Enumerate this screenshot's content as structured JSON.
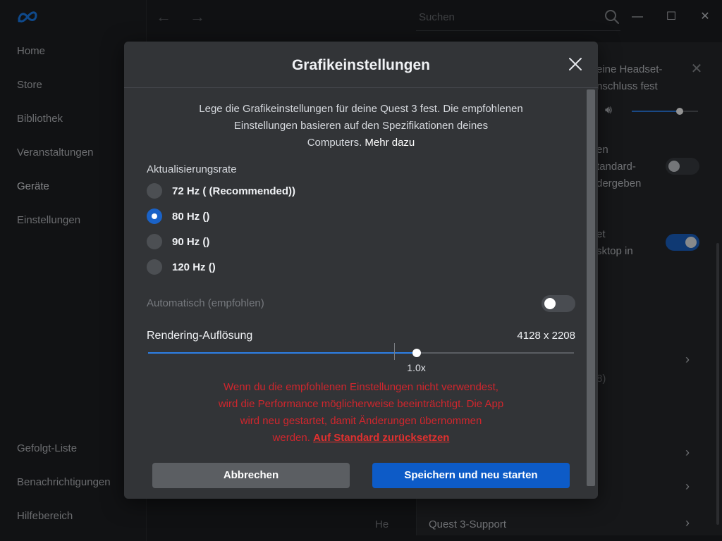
{
  "sidebar": {
    "items": [
      {
        "label": "Home"
      },
      {
        "label": "Store"
      },
      {
        "label": "Bibliothek"
      },
      {
        "label": "Veranstaltungen"
      },
      {
        "label": "Geräte"
      },
      {
        "label": "Einstellungen"
      }
    ],
    "bottom_items": [
      {
        "label": "Gefolgt-Liste"
      },
      {
        "label": "Benachrichtigungen"
      },
      {
        "label": "Hilfebereich"
      }
    ]
  },
  "topbar": {
    "search_placeholder": "Suchen"
  },
  "right_panel": {
    "line1": "eine Headset-",
    "line2": "nschluss fest",
    "line3": "en",
    "line4": "tandard-",
    "line5": "dergeben",
    "line6": "et",
    "line7": "sktop in",
    "line8": "8)",
    "help_fragment": "He",
    "support_label": "Quest 3-Support",
    "toggle1_on": false,
    "toggle2_on": true,
    "volume_level": 0.72
  },
  "dialog": {
    "title": "Grafikeinstellungen",
    "intro_line1": "Lege die Grafikeinstellungen für deine Quest 3 fest. Die empfohlenen",
    "intro_line2": "Einstellungen basieren auf den Spezifikationen deines",
    "intro_line3": "Computers.",
    "intro_link": "Mehr dazu",
    "refresh_label": "Aktualisierungsrate",
    "refresh_options": [
      {
        "label": "72 Hz ( (Recommended))",
        "checked": false
      },
      {
        "label": "80 Hz ()",
        "checked": true
      },
      {
        "label": "90 Hz ()",
        "checked": false
      },
      {
        "label": "120 Hz ()",
        "checked": false
      }
    ],
    "auto_label": "Automatisch (empfohlen)",
    "auto_on": false,
    "resolution_label": "Rendering-Auflösung",
    "resolution_value": "4128 x 2208",
    "slider_value_label": "1.0x",
    "slider_fraction": 0.63,
    "warning_line1": "Wenn du die empfohlenen Einstellungen nicht verwendest,",
    "warning_line2": "wird die Performance möglicherweise beeinträchtigt. Die App",
    "warning_line3": "wird neu gestartet, damit Änderungen übernommen",
    "warning_line4": "werden.",
    "warning_link": "Auf Standard zurücksetzen",
    "cancel_label": "Abbrechen",
    "save_label": "Speichern und neu starten"
  },
  "colors": {
    "accent": "#1a62c7",
    "warning": "#d0262d"
  }
}
